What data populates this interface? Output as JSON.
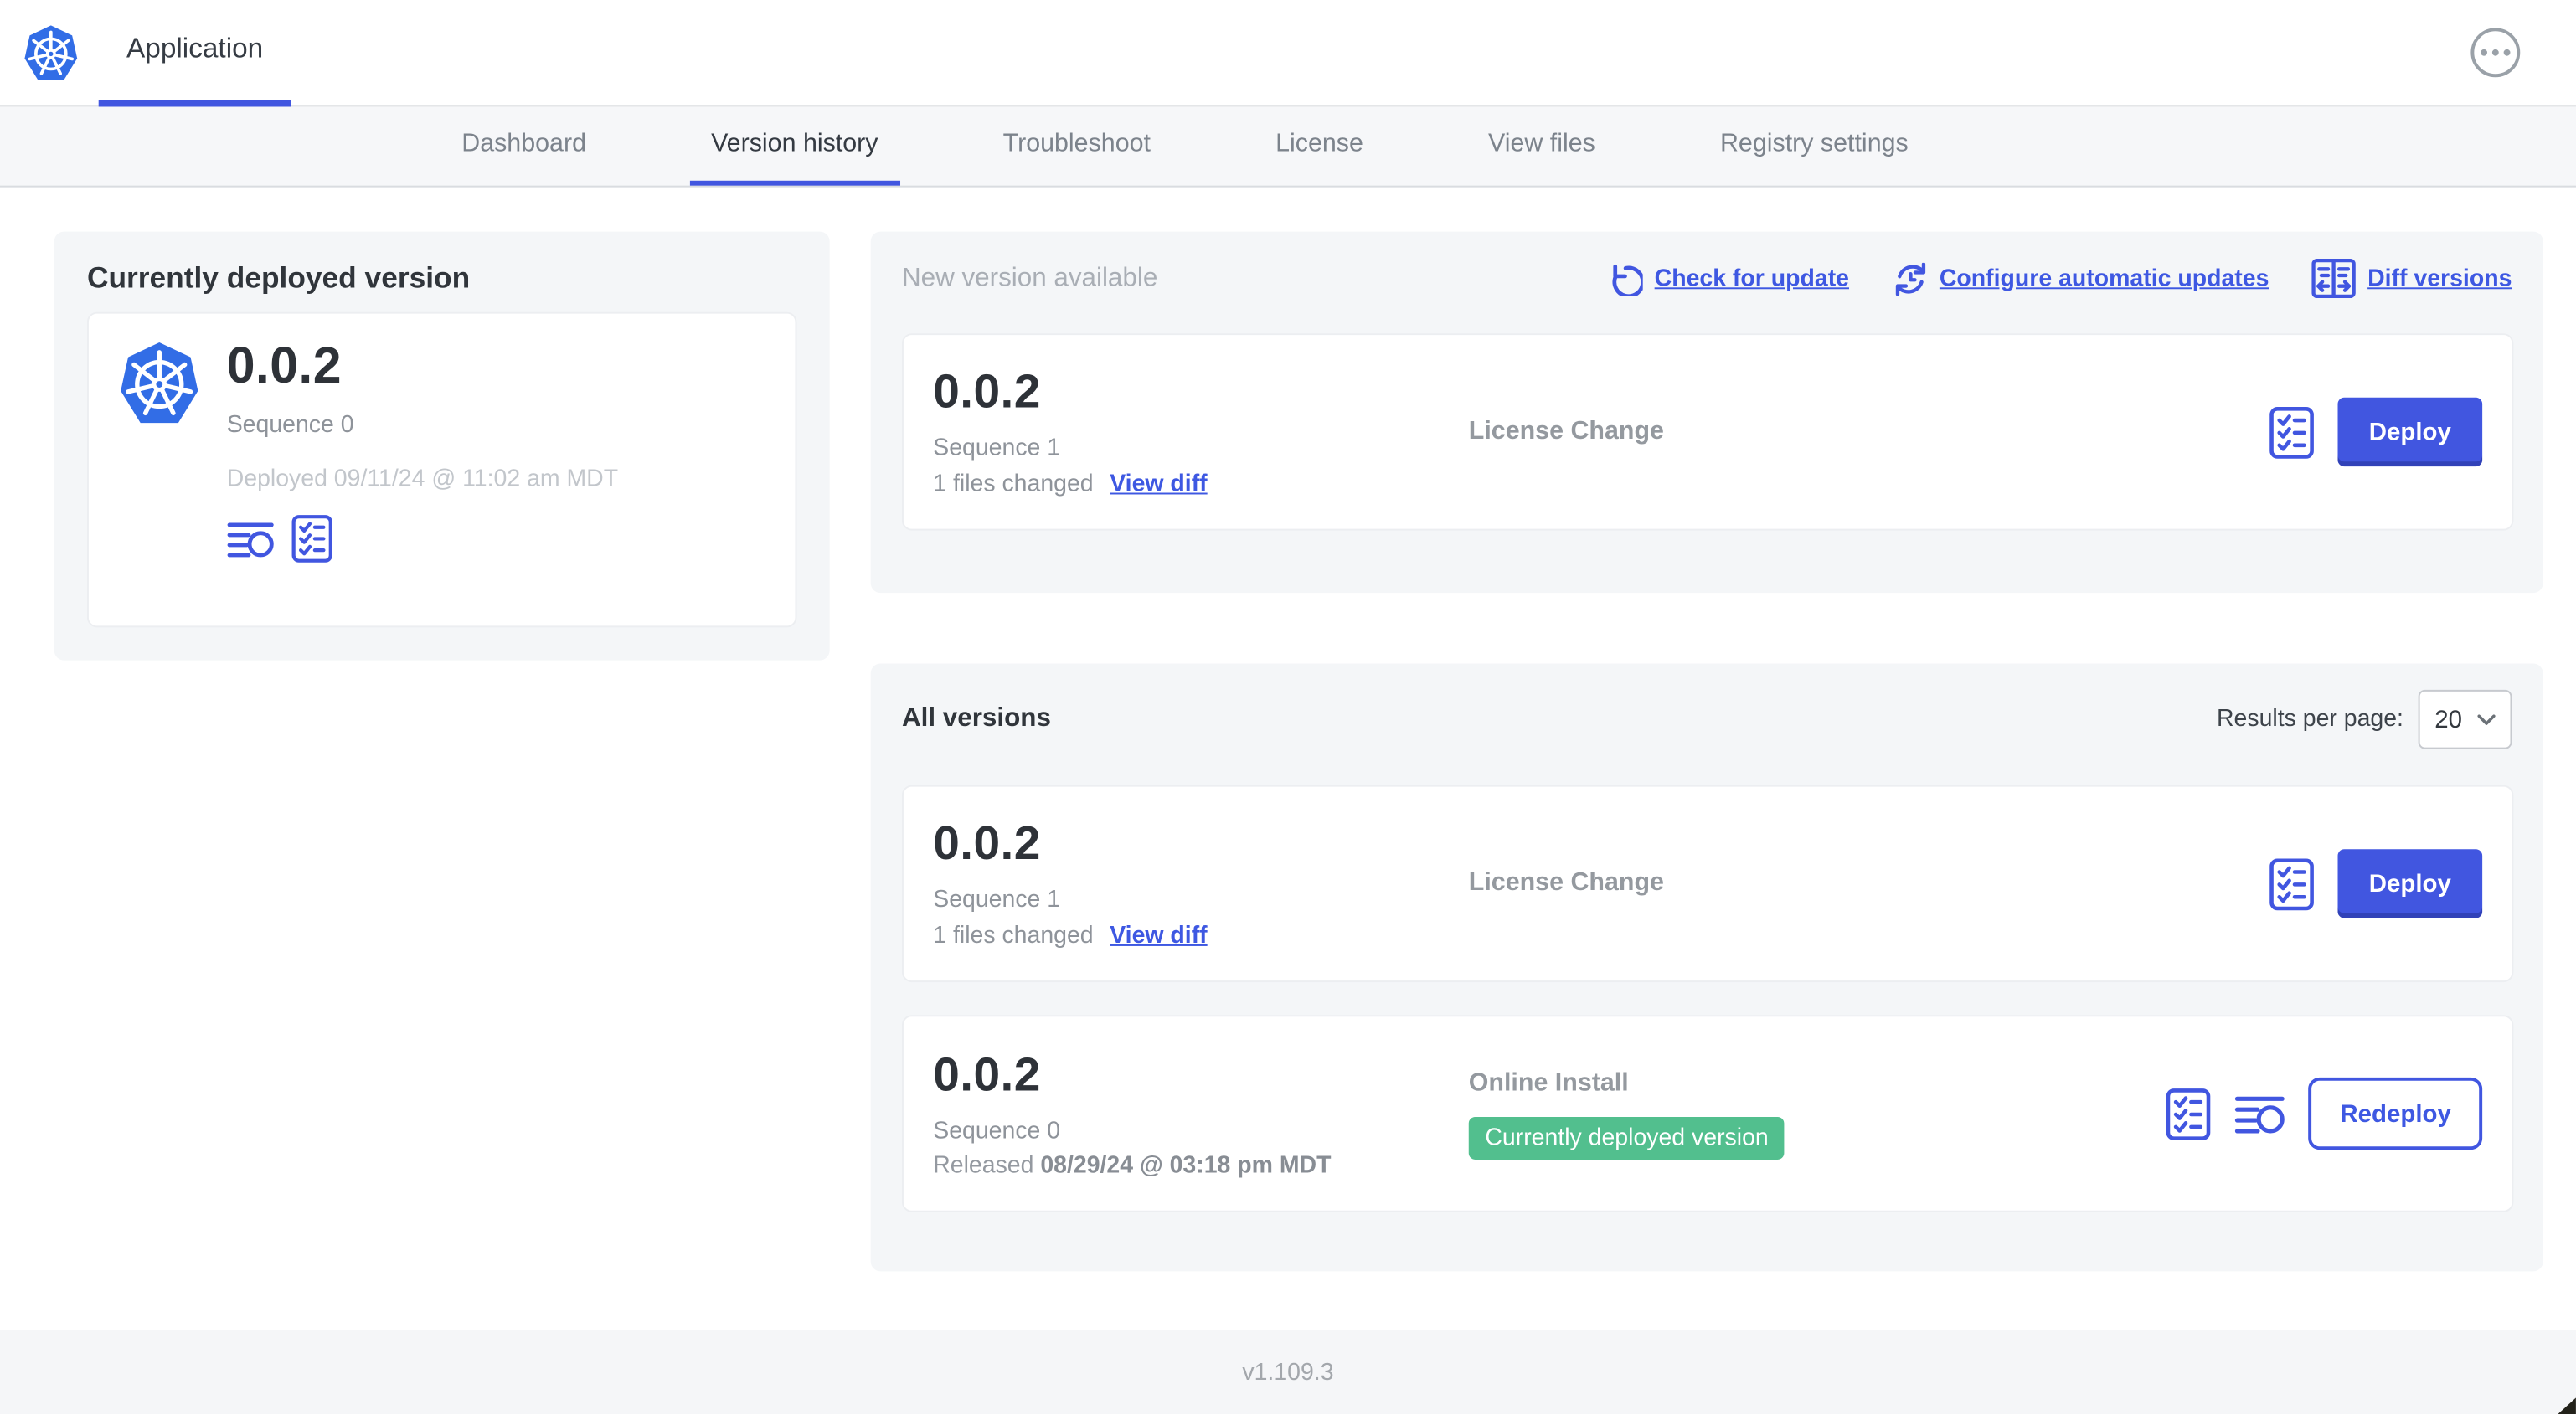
{
  "header": {
    "app_tab": "Application",
    "logo_icon": "kubernetes-logo-icon",
    "more_icon": "ellipsis-icon"
  },
  "nav": {
    "tabs": [
      {
        "label": "Dashboard",
        "active": false
      },
      {
        "label": "Version history",
        "active": true
      },
      {
        "label": "Troubleshoot",
        "active": false
      },
      {
        "label": "License",
        "active": false
      },
      {
        "label": "View files",
        "active": false
      },
      {
        "label": "Registry settings",
        "active": false
      }
    ]
  },
  "current_version_panel": {
    "title": "Currently deployed version",
    "version": "0.0.2",
    "sequence": "Sequence 0",
    "deployed": "Deployed 09/11/24 @ 11:02 am MDT",
    "icons": [
      "logs-icon",
      "checklist-icon"
    ]
  },
  "new_version_section": {
    "title": "New version available",
    "actions": [
      {
        "label": "Check for update",
        "icon": "refresh-icon"
      },
      {
        "label": "Configure automatic updates",
        "icon": "auto-update-icon"
      },
      {
        "label": "Diff versions",
        "icon": "diff-icon"
      }
    ],
    "card": {
      "version": "0.0.2",
      "sequence": "Sequence 1",
      "files_changed": "1 files changed",
      "view_diff_label": "View diff",
      "source": "License Change",
      "deploy_label": "Deploy",
      "icons": [
        "checklist-icon"
      ]
    }
  },
  "all_versions_section": {
    "title": "All versions",
    "results_per_page_label": "Results per page:",
    "results_per_page_value": "20",
    "rows": [
      {
        "version": "0.0.2",
        "sequence": "Sequence 1",
        "files_changed": "1 files changed",
        "view_diff_label": "View diff",
        "source": "License Change",
        "action_label": "Deploy",
        "icons": [
          "checklist-icon"
        ]
      },
      {
        "version": "0.0.2",
        "sequence": "Sequence 0",
        "released_label": "Released",
        "released_date": "08/29/24 @ 03:18 pm MDT",
        "source": "Online Install",
        "badge": "Currently deployed version",
        "action_label": "Redeploy",
        "icons": [
          "checklist-icon",
          "logs-icon"
        ]
      }
    ]
  },
  "footer": {
    "version": "v1.109.3"
  },
  "colors": {
    "accent_blue": "#4156e0",
    "link_blue": "#3e58e2",
    "kubernetes_blue": "#326de6",
    "badge_green": "#52bf8e",
    "section_bg": "#f4f6f8",
    "nav_bg": "#f6f7f9"
  }
}
